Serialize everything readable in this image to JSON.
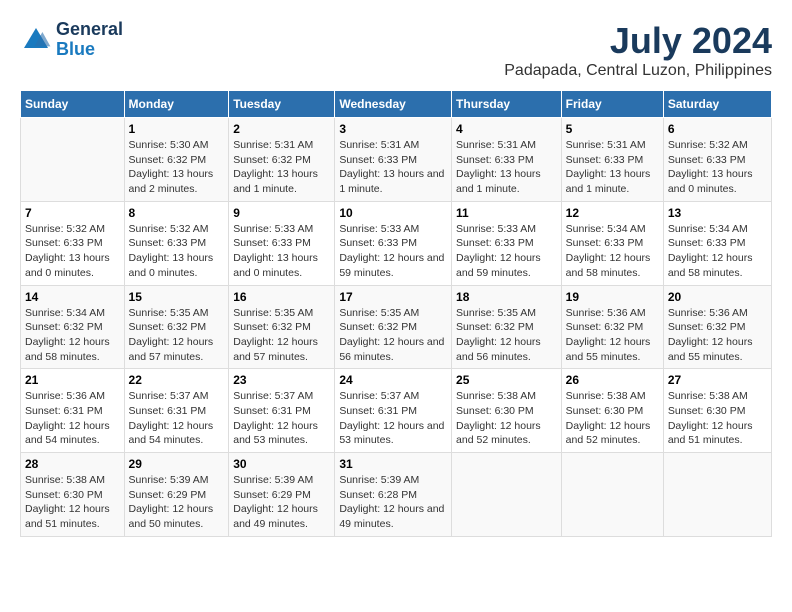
{
  "header": {
    "logo_line1": "General",
    "logo_line2": "Blue",
    "title": "July 2024",
    "subtitle": "Padapada, Central Luzon, Philippines"
  },
  "days_of_week": [
    "Sunday",
    "Monday",
    "Tuesday",
    "Wednesday",
    "Thursday",
    "Friday",
    "Saturday"
  ],
  "weeks": [
    [
      {
        "num": "",
        "sunrise": "",
        "sunset": "",
        "daylight": ""
      },
      {
        "num": "1",
        "sunrise": "Sunrise: 5:30 AM",
        "sunset": "Sunset: 6:32 PM",
        "daylight": "Daylight: 13 hours and 2 minutes."
      },
      {
        "num": "2",
        "sunrise": "Sunrise: 5:31 AM",
        "sunset": "Sunset: 6:32 PM",
        "daylight": "Daylight: 13 hours and 1 minute."
      },
      {
        "num": "3",
        "sunrise": "Sunrise: 5:31 AM",
        "sunset": "Sunset: 6:33 PM",
        "daylight": "Daylight: 13 hours and 1 minute."
      },
      {
        "num": "4",
        "sunrise": "Sunrise: 5:31 AM",
        "sunset": "Sunset: 6:33 PM",
        "daylight": "Daylight: 13 hours and 1 minute."
      },
      {
        "num": "5",
        "sunrise": "Sunrise: 5:31 AM",
        "sunset": "Sunset: 6:33 PM",
        "daylight": "Daylight: 13 hours and 1 minute."
      },
      {
        "num": "6",
        "sunrise": "Sunrise: 5:32 AM",
        "sunset": "Sunset: 6:33 PM",
        "daylight": "Daylight: 13 hours and 0 minutes."
      }
    ],
    [
      {
        "num": "7",
        "sunrise": "Sunrise: 5:32 AM",
        "sunset": "Sunset: 6:33 PM",
        "daylight": "Daylight: 13 hours and 0 minutes."
      },
      {
        "num": "8",
        "sunrise": "Sunrise: 5:32 AM",
        "sunset": "Sunset: 6:33 PM",
        "daylight": "Daylight: 13 hours and 0 minutes."
      },
      {
        "num": "9",
        "sunrise": "Sunrise: 5:33 AM",
        "sunset": "Sunset: 6:33 PM",
        "daylight": "Daylight: 13 hours and 0 minutes."
      },
      {
        "num": "10",
        "sunrise": "Sunrise: 5:33 AM",
        "sunset": "Sunset: 6:33 PM",
        "daylight": "Daylight: 12 hours and 59 minutes."
      },
      {
        "num": "11",
        "sunrise": "Sunrise: 5:33 AM",
        "sunset": "Sunset: 6:33 PM",
        "daylight": "Daylight: 12 hours and 59 minutes."
      },
      {
        "num": "12",
        "sunrise": "Sunrise: 5:34 AM",
        "sunset": "Sunset: 6:33 PM",
        "daylight": "Daylight: 12 hours and 58 minutes."
      },
      {
        "num": "13",
        "sunrise": "Sunrise: 5:34 AM",
        "sunset": "Sunset: 6:33 PM",
        "daylight": "Daylight: 12 hours and 58 minutes."
      }
    ],
    [
      {
        "num": "14",
        "sunrise": "Sunrise: 5:34 AM",
        "sunset": "Sunset: 6:32 PM",
        "daylight": "Daylight: 12 hours and 58 minutes."
      },
      {
        "num": "15",
        "sunrise": "Sunrise: 5:35 AM",
        "sunset": "Sunset: 6:32 PM",
        "daylight": "Daylight: 12 hours and 57 minutes."
      },
      {
        "num": "16",
        "sunrise": "Sunrise: 5:35 AM",
        "sunset": "Sunset: 6:32 PM",
        "daylight": "Daylight: 12 hours and 57 minutes."
      },
      {
        "num": "17",
        "sunrise": "Sunrise: 5:35 AM",
        "sunset": "Sunset: 6:32 PM",
        "daylight": "Daylight: 12 hours and 56 minutes."
      },
      {
        "num": "18",
        "sunrise": "Sunrise: 5:35 AM",
        "sunset": "Sunset: 6:32 PM",
        "daylight": "Daylight: 12 hours and 56 minutes."
      },
      {
        "num": "19",
        "sunrise": "Sunrise: 5:36 AM",
        "sunset": "Sunset: 6:32 PM",
        "daylight": "Daylight: 12 hours and 55 minutes."
      },
      {
        "num": "20",
        "sunrise": "Sunrise: 5:36 AM",
        "sunset": "Sunset: 6:32 PM",
        "daylight": "Daylight: 12 hours and 55 minutes."
      }
    ],
    [
      {
        "num": "21",
        "sunrise": "Sunrise: 5:36 AM",
        "sunset": "Sunset: 6:31 PM",
        "daylight": "Daylight: 12 hours and 54 minutes."
      },
      {
        "num": "22",
        "sunrise": "Sunrise: 5:37 AM",
        "sunset": "Sunset: 6:31 PM",
        "daylight": "Daylight: 12 hours and 54 minutes."
      },
      {
        "num": "23",
        "sunrise": "Sunrise: 5:37 AM",
        "sunset": "Sunset: 6:31 PM",
        "daylight": "Daylight: 12 hours and 53 minutes."
      },
      {
        "num": "24",
        "sunrise": "Sunrise: 5:37 AM",
        "sunset": "Sunset: 6:31 PM",
        "daylight": "Daylight: 12 hours and 53 minutes."
      },
      {
        "num": "25",
        "sunrise": "Sunrise: 5:38 AM",
        "sunset": "Sunset: 6:30 PM",
        "daylight": "Daylight: 12 hours and 52 minutes."
      },
      {
        "num": "26",
        "sunrise": "Sunrise: 5:38 AM",
        "sunset": "Sunset: 6:30 PM",
        "daylight": "Daylight: 12 hours and 52 minutes."
      },
      {
        "num": "27",
        "sunrise": "Sunrise: 5:38 AM",
        "sunset": "Sunset: 6:30 PM",
        "daylight": "Daylight: 12 hours and 51 minutes."
      }
    ],
    [
      {
        "num": "28",
        "sunrise": "Sunrise: 5:38 AM",
        "sunset": "Sunset: 6:30 PM",
        "daylight": "Daylight: 12 hours and 51 minutes."
      },
      {
        "num": "29",
        "sunrise": "Sunrise: 5:39 AM",
        "sunset": "Sunset: 6:29 PM",
        "daylight": "Daylight: 12 hours and 50 minutes."
      },
      {
        "num": "30",
        "sunrise": "Sunrise: 5:39 AM",
        "sunset": "Sunset: 6:29 PM",
        "daylight": "Daylight: 12 hours and 49 minutes."
      },
      {
        "num": "31",
        "sunrise": "Sunrise: 5:39 AM",
        "sunset": "Sunset: 6:28 PM",
        "daylight": "Daylight: 12 hours and 49 minutes."
      },
      {
        "num": "",
        "sunrise": "",
        "sunset": "",
        "daylight": ""
      },
      {
        "num": "",
        "sunrise": "",
        "sunset": "",
        "daylight": ""
      },
      {
        "num": "",
        "sunrise": "",
        "sunset": "",
        "daylight": ""
      }
    ]
  ]
}
